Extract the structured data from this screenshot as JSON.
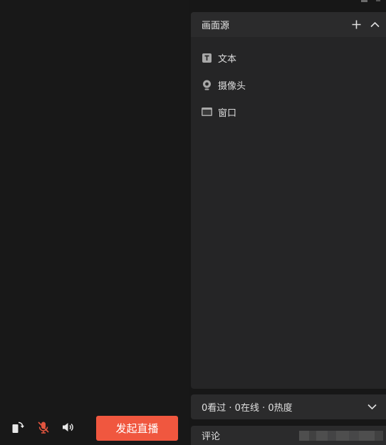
{
  "sources": {
    "title": "画面源",
    "add_icon": "plus-icon",
    "collapse_icon": "chevron-up-icon",
    "items": [
      {
        "label": "文本",
        "icon": "text-icon"
      },
      {
        "label": "摄像头",
        "icon": "camera-icon"
      },
      {
        "label": "窗口",
        "icon": "window-icon"
      }
    ]
  },
  "stats": {
    "text": "0看过 · 0在线 · 0热度",
    "expand_icon": "chevron-down-icon"
  },
  "comments": {
    "label": "评论"
  },
  "controls": {
    "rotate_icon": "rotate-screen-icon",
    "mic_icon": "mic-muted-icon",
    "volume_icon": "volume-icon",
    "go_live_label": "发起直播"
  },
  "colors": {
    "accent": "#f0573f",
    "panel": "#252526",
    "header": "#2b2b2c",
    "background": "#171717",
    "mic_muted": "#e2553f"
  }
}
